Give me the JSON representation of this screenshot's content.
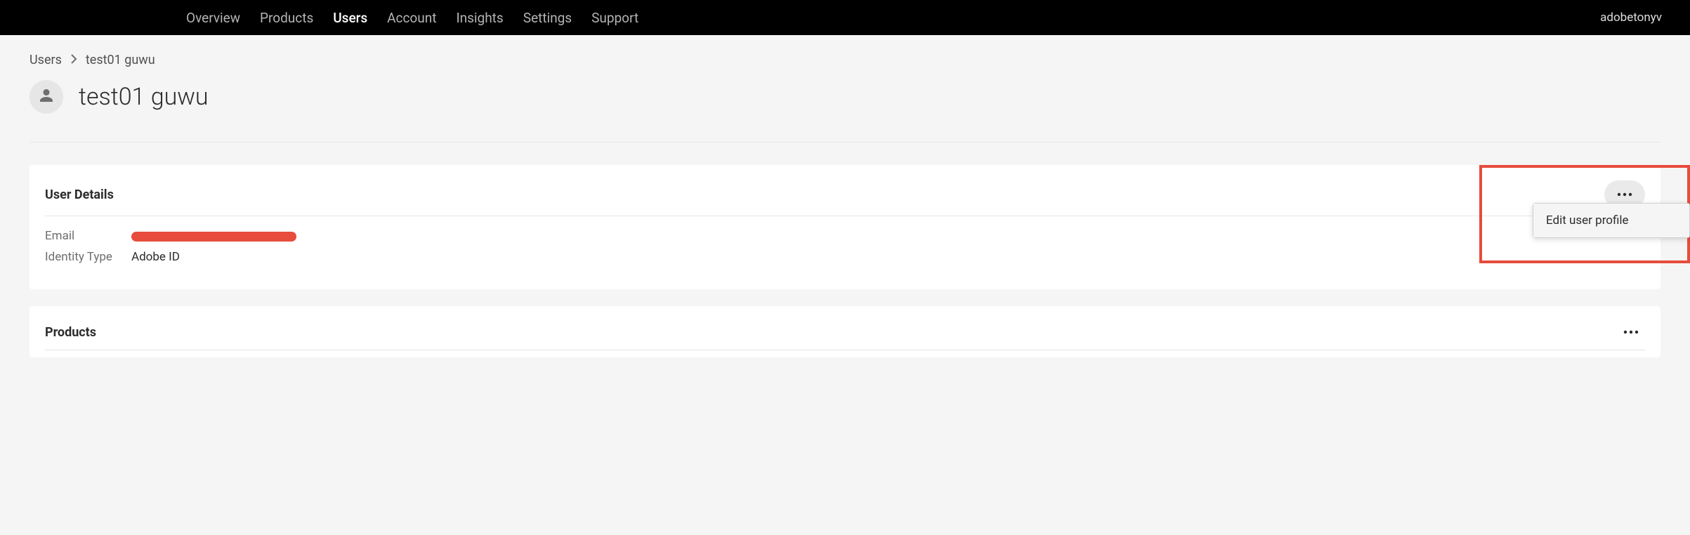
{
  "topnav": {
    "items": [
      {
        "label": "Overview",
        "active": false
      },
      {
        "label": "Products",
        "active": false
      },
      {
        "label": "Users",
        "active": true
      },
      {
        "label": "Account",
        "active": false
      },
      {
        "label": "Insights",
        "active": false
      },
      {
        "label": "Settings",
        "active": false
      },
      {
        "label": "Support",
        "active": false
      }
    ],
    "account_label": "adobetonyv"
  },
  "breadcrumb": {
    "root": "Users",
    "current": "test01 guwu"
  },
  "page": {
    "title": "test01 guwu"
  },
  "user_details": {
    "section_title": "User Details",
    "email_label": "Email",
    "email_value_redacted": true,
    "identity_type_label": "Identity Type",
    "identity_type_value": "Adobe ID",
    "menu": {
      "edit_profile_label": "Edit user profile"
    }
  },
  "products": {
    "section_title": "Products"
  }
}
